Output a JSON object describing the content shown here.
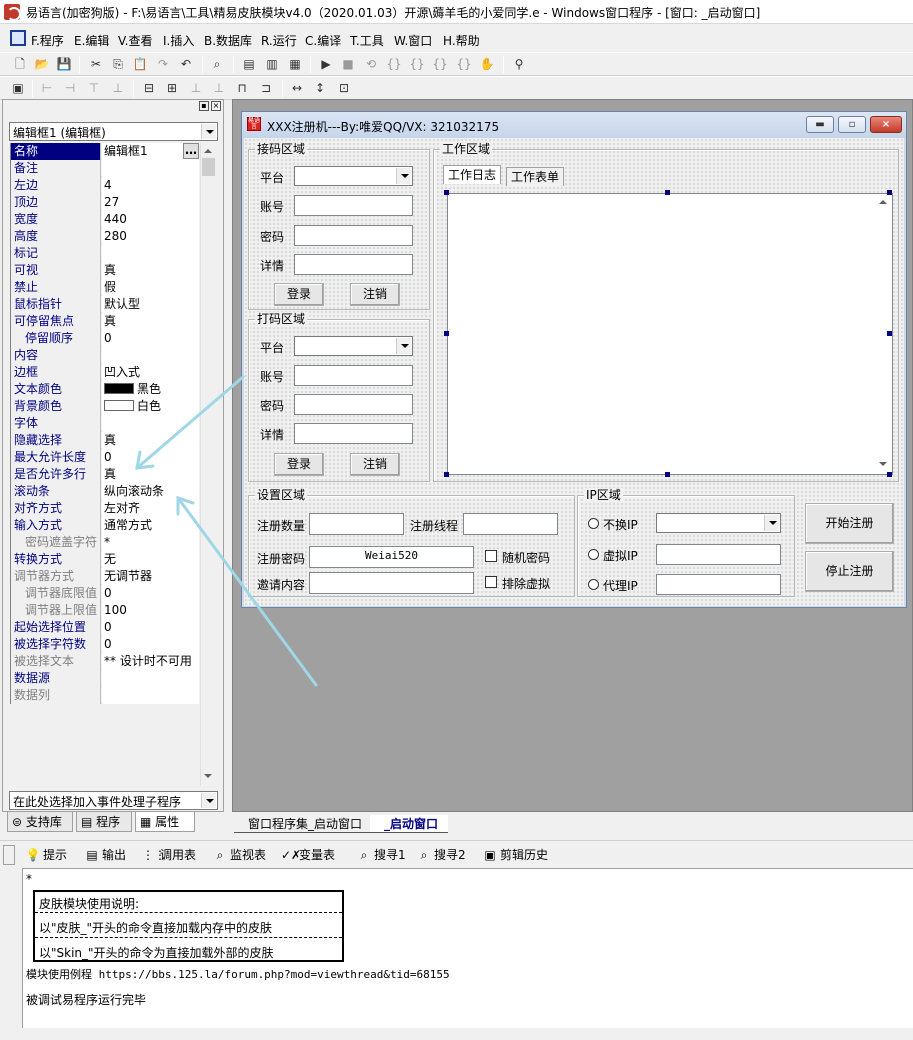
{
  "window": {
    "title": "易语言(加密狗版) - F:\\易语言\\工具\\精易皮肤模块v4.0（2020.01.03）开源\\薅羊毛的小爱同学.e - Windows窗口程序 - [窗口: _启动窗口]"
  },
  "menu": [
    {
      "label": "F.程序"
    },
    {
      "label": "E.编辑"
    },
    {
      "label": "V.查看"
    },
    {
      "label": "I.插入"
    },
    {
      "label": "B.数据库"
    },
    {
      "label": "R.运行"
    },
    {
      "label": "C.编译"
    },
    {
      "label": "T.工具"
    },
    {
      "label": "W.窗口"
    },
    {
      "label": "H.帮助"
    }
  ],
  "left_panel": {
    "component_select": "编辑框1 (编辑框)",
    "event_select": "在此处选择加入事件处理子程序",
    "tabs": [
      {
        "label": "支持库"
      },
      {
        "label": "程序"
      },
      {
        "label": "属性"
      }
    ],
    "properties": [
      {
        "name": "名称",
        "value": "编辑框1",
        "selected": true,
        "has_button": true
      },
      {
        "name": "备注",
        "value": ""
      },
      {
        "name": "左边",
        "value": "4"
      },
      {
        "name": "顶边",
        "value": "27"
      },
      {
        "name": "宽度",
        "value": "440"
      },
      {
        "name": "高度",
        "value": "280"
      },
      {
        "name": "标记",
        "value": ""
      },
      {
        "name": "可视",
        "value": "真"
      },
      {
        "name": "禁止",
        "value": "假"
      },
      {
        "name": "鼠标指针",
        "value": "默认型"
      },
      {
        "name": "可停留焦点",
        "value": "真"
      },
      {
        "name": "停留顺序",
        "value": "0",
        "indent": true
      },
      {
        "name": "内容",
        "value": ""
      },
      {
        "name": "边框",
        "value": "凹入式"
      },
      {
        "name": "文本颜色",
        "value": "黑色",
        "swatch": "#000000"
      },
      {
        "name": "背景颜色",
        "value": "白色",
        "swatch": "#ffffff"
      },
      {
        "name": "字体",
        "value": ""
      },
      {
        "name": "隐藏选择",
        "value": "真"
      },
      {
        "name": "最大允许长度",
        "value": "0"
      },
      {
        "name": "是否允许多行",
        "value": "真"
      },
      {
        "name": "滚动条",
        "value": "纵向滚动条"
      },
      {
        "name": "对齐方式",
        "value": "左对齐"
      },
      {
        "name": "输入方式",
        "value": "通常方式"
      },
      {
        "name": "密码遮盖字符",
        "value": "*",
        "indent": true,
        "disabled": true
      },
      {
        "name": "转换方式",
        "value": "无"
      },
      {
        "name": "调节器方式",
        "value": "无调节器",
        "disabled": true
      },
      {
        "name": "调节器底限值",
        "value": "0",
        "indent": true,
        "disabled": true
      },
      {
        "name": "调节器上限值",
        "value": "100",
        "indent": true,
        "disabled": true
      },
      {
        "name": "起始选择位置",
        "value": "0"
      },
      {
        "name": "被选择字符数",
        "value": "0"
      },
      {
        "name": "被选择文本",
        "value": "** 设计时不可用",
        "disabled": true
      },
      {
        "name": "数据源",
        "value": ""
      },
      {
        "name": "数据列",
        "value": "",
        "disabled": true
      }
    ]
  },
  "form": {
    "title": "XXX注册机---By:唯爱QQ/VX:  321032175",
    "icon_text": "易语言",
    "group_receive": {
      "title": "接码区域",
      "platform_label": "平台",
      "account_label": "账号",
      "password_label": "密码",
      "details_label": "详情",
      "login_btn": "登录",
      "logout_btn": "注销"
    },
    "group_captcha": {
      "title": "打码区域",
      "platform_label": "平台",
      "account_label": "账号",
      "password_label": "密码",
      "details_label": "详情",
      "login_btn": "登录",
      "logout_btn": "注销"
    },
    "group_work": {
      "title": "工作区域",
      "tab_log": "工作日志",
      "tab_table": "工作表单"
    },
    "group_settings": {
      "title": "设置区域",
      "reg_count_label": "注册数量",
      "reg_thread_label": "注册线程",
      "reg_password_label": "注册密码",
      "reg_password_value": "Weiai520",
      "invite_label": "邀请内容",
      "random_pwd_label": "随机密码",
      "exclude_virtual_label": "排除虚拟"
    },
    "group_ip": {
      "title": "IP区域",
      "no_change": "不换IP",
      "virtual": "虚拟IP",
      "proxy": "代理IP"
    },
    "start_btn": "开始注册",
    "stop_btn": "停止注册"
  },
  "design_tabs": [
    {
      "label": "窗口程序集_启动窗口"
    },
    {
      "label": "_启动窗口"
    }
  ],
  "bottom_tabs": [
    {
      "label": "提示",
      "icon": "lightbulb-icon"
    },
    {
      "label": "输出",
      "icon": "output-icon"
    },
    {
      "label": "调用表",
      "icon": "call-table-icon"
    },
    {
      "label": "监视表",
      "icon": "magnifier-icon"
    },
    {
      "label": "变量表",
      "icon": "variable-icon"
    },
    {
      "label": "搜寻1",
      "icon": "search-icon"
    },
    {
      "label": "搜寻2",
      "icon": "search-icon"
    },
    {
      "label": "剪辑历史",
      "icon": "clipboard-icon"
    }
  ],
  "output": {
    "star": "*",
    "note_title": "皮肤模块使用说明:",
    "note_line1": "以\"皮肤_\"开头的命令直接加载内存中的皮肤",
    "note_line2": "以\"Skin_\"开头的命令为直接加载外部的皮肤",
    "example_line": "模块使用例程 https://bbs.125.la/forum.php?mod=viewthread&tid=68155",
    "done_line": "被调试易程序运行完毕"
  }
}
